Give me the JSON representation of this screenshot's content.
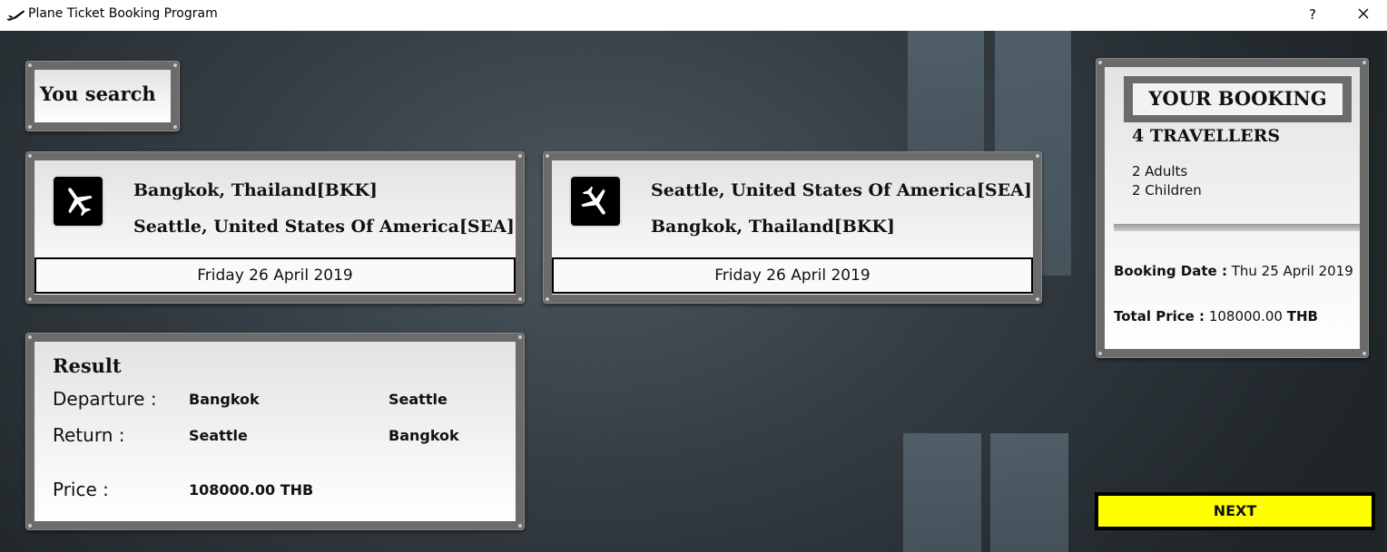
{
  "window": {
    "title": "Plane Ticket Booking Program",
    "help_label": "?"
  },
  "search": {
    "heading": "You search"
  },
  "outbound": {
    "from": "Bangkok, Thailand[BKK]",
    "to": "Seattle, United States Of America[SEA]",
    "date": "Friday 26 April 2019",
    "icon": "plane-takeoff-icon"
  },
  "return_flight": {
    "from": "Seattle, United States Of America[SEA]",
    "to": "Bangkok, Thailand[BKK]",
    "date": "Friday 26 April 2019",
    "icon": "plane-landing-icon"
  },
  "result": {
    "heading": "Result",
    "departure_label": "Departure :",
    "departure_from": "Bangkok",
    "departure_to": "Seattle",
    "return_label": "Return :",
    "return_from": "Seattle",
    "return_to": "Bangkok",
    "price_label": "Price :",
    "price_value": "108000.00 THB"
  },
  "booking": {
    "heading": "YOUR BOOKING",
    "travellers_count": "4",
    "travellers_label": "TRAVELLERS",
    "adults": "2 Adults",
    "children": "2 Children",
    "date_label": "Booking Date :",
    "date_value": "Thu 25 April 2019",
    "price_label": "Total Price :",
    "price_value": "108000.00",
    "price_currency": "THB"
  },
  "actions": {
    "next_label": "NEXT"
  },
  "colors": {
    "accent": "#ffff00",
    "frame": "#6b6b6b"
  }
}
